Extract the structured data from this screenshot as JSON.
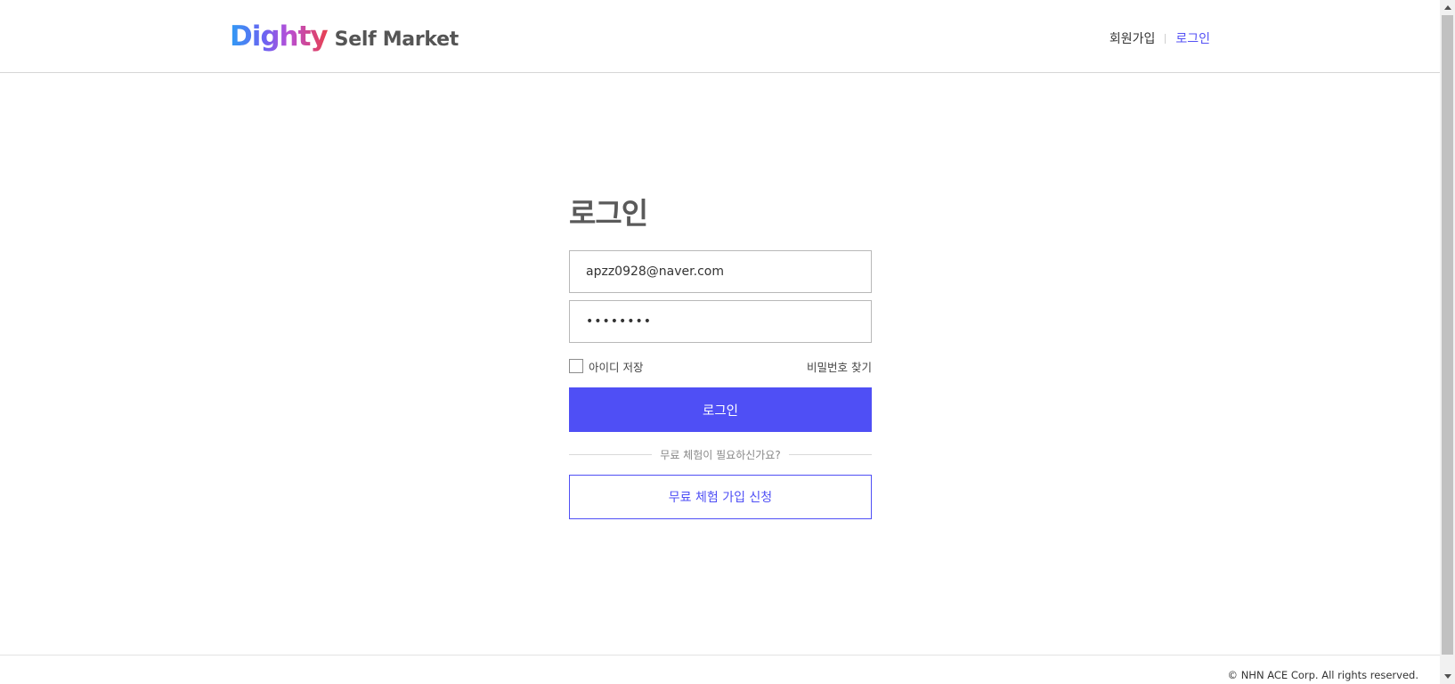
{
  "header": {
    "logo_mark": "Dighty",
    "logo_text": "Self Market",
    "nav_signup": "회원가입",
    "nav_login": "로그인"
  },
  "login": {
    "title": "로그인",
    "email_value": "apzz0928@naver.com",
    "password_value": "••••••••",
    "remember_label": "아이디 저장",
    "remember_checked": false,
    "find_password": "비밀번호 찾기",
    "submit_label": "로그인",
    "divider_text": "무료 체험이 필요하신가요?",
    "trial_label": "무료 체험 가입 신청"
  },
  "footer": {
    "copyright": "© NHN ACE Corp. All rights reserved."
  },
  "colors": {
    "accent": "#4f4ff5",
    "nav_active": "#5551f5",
    "title": "#5a5a5a"
  }
}
